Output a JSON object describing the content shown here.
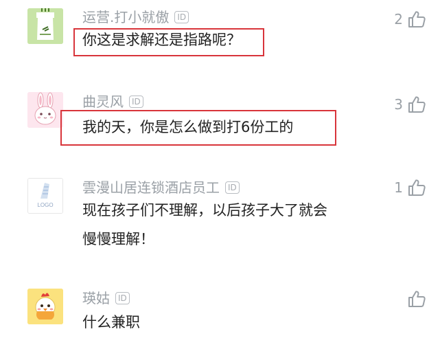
{
  "comments": [
    {
      "username": "运营.打小就傲",
      "id_badge": "ID",
      "text_lines": [
        "你这是求解还是指路呢？"
      ],
      "likes": "2",
      "highlighted": true,
      "avatar_icon": "green-pot-avatar-icon"
    },
    {
      "username": "曲灵风",
      "id_badge": "ID",
      "text_lines": [
        "我的天，你是怎么做到打6份工的"
      ],
      "likes": "3",
      "highlighted": true,
      "avatar_icon": "pink-rabbit-avatar-icon"
    },
    {
      "username": "雲漫山居连锁酒店员工",
      "id_badge": "ID",
      "text_lines": [
        "现在孩子们不理解，以后孩子大了就会",
        "慢慢理解！"
      ],
      "likes": "1",
      "highlighted": false,
      "avatar_icon": "logo-placeholder-avatar-icon",
      "avatar_text": "LOGO"
    },
    {
      "username": "瑛姑",
      "id_badge": "ID",
      "text_lines": [
        "什么兼职"
      ],
      "likes": "",
      "highlighted": false,
      "avatar_icon": "chick-avatar-icon"
    }
  ],
  "colors": {
    "highlight_border": "#d8343a",
    "username": "#9aa0a6",
    "text": "#222222"
  },
  "icons": {
    "like": "thumbs-up-icon"
  }
}
